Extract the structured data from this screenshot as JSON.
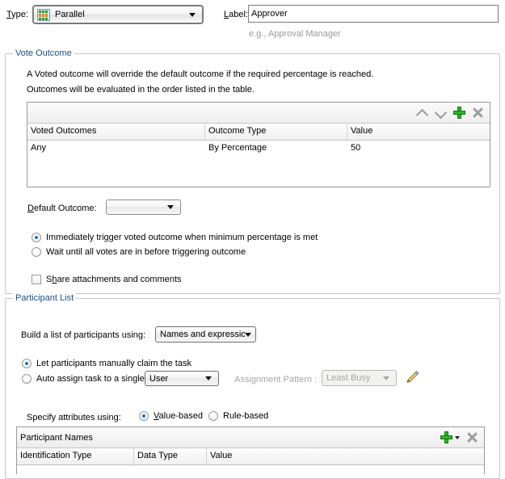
{
  "top": {
    "type_label": "Type:",
    "type_value": "Parallel",
    "type_icon": "parallel-participants-icon",
    "label_label": "Label:",
    "label_value": "Approver",
    "label_hint": "e.g., Approval Manager"
  },
  "vote_outcome": {
    "legend": "Vote Outcome",
    "description_line1": "A Voted outcome will override the default outcome if the required percentage is reached.",
    "description_line2": "Outcomes will be evaluated in the order listed in the table.",
    "toolbar": {
      "title": "",
      "move_up_icon": "chevron-up-icon",
      "move_down_icon": "chevron-down-icon",
      "add_icon": "plus-icon",
      "delete_icon": "cross-icon"
    },
    "table": {
      "columns": [
        "Voted Outcomes",
        "Outcome Type",
        "Value"
      ],
      "rows": [
        [
          "Any",
          "By Percentage",
          "50"
        ]
      ]
    },
    "default_outcome_label": "Default Outcome:",
    "default_outcome_value": "",
    "trigger_options": [
      {
        "label": "Immediately trigger voted outcome when minimum percentage is met",
        "selected": true
      },
      {
        "label": "Wait until all votes are in before triggering outcome",
        "selected": false
      }
    ],
    "share_checkbox": {
      "label": "Share attachments and comments",
      "checked": false
    }
  },
  "participant_list": {
    "legend": "Participant List",
    "build_label": "Build a list of participants using:",
    "build_value": "Names and expressions",
    "assign_options": [
      {
        "label": "Let participants manually claim the task",
        "selected": true
      },
      {
        "label": "Auto assign task to a single",
        "selected": false
      }
    ],
    "user_combo_value": "User",
    "assignment_pattern_label": "Assignment Pattern :",
    "assignment_pattern_value": "Least Busy",
    "edit_icon": "pencil-icon",
    "specify_label": "Specify attributes using:",
    "specify_options": [
      {
        "label": "Value-based",
        "selected": true
      },
      {
        "label": "Rule-based",
        "selected": false
      }
    ],
    "participants_table": {
      "title": "Participant Names",
      "add_icon": "plus-dropdown-icon",
      "delete_icon": "cross-icon",
      "columns": [
        "Identification Type",
        "Data Type",
        "Value"
      ],
      "rows": []
    }
  },
  "colors": {
    "legend_text": "#1c4f8c",
    "hint_text": "#9a9a9a",
    "add_green": "#2db52d",
    "radio_dot": "#2a6fc4",
    "disabled_text": "#a6a6a6"
  }
}
